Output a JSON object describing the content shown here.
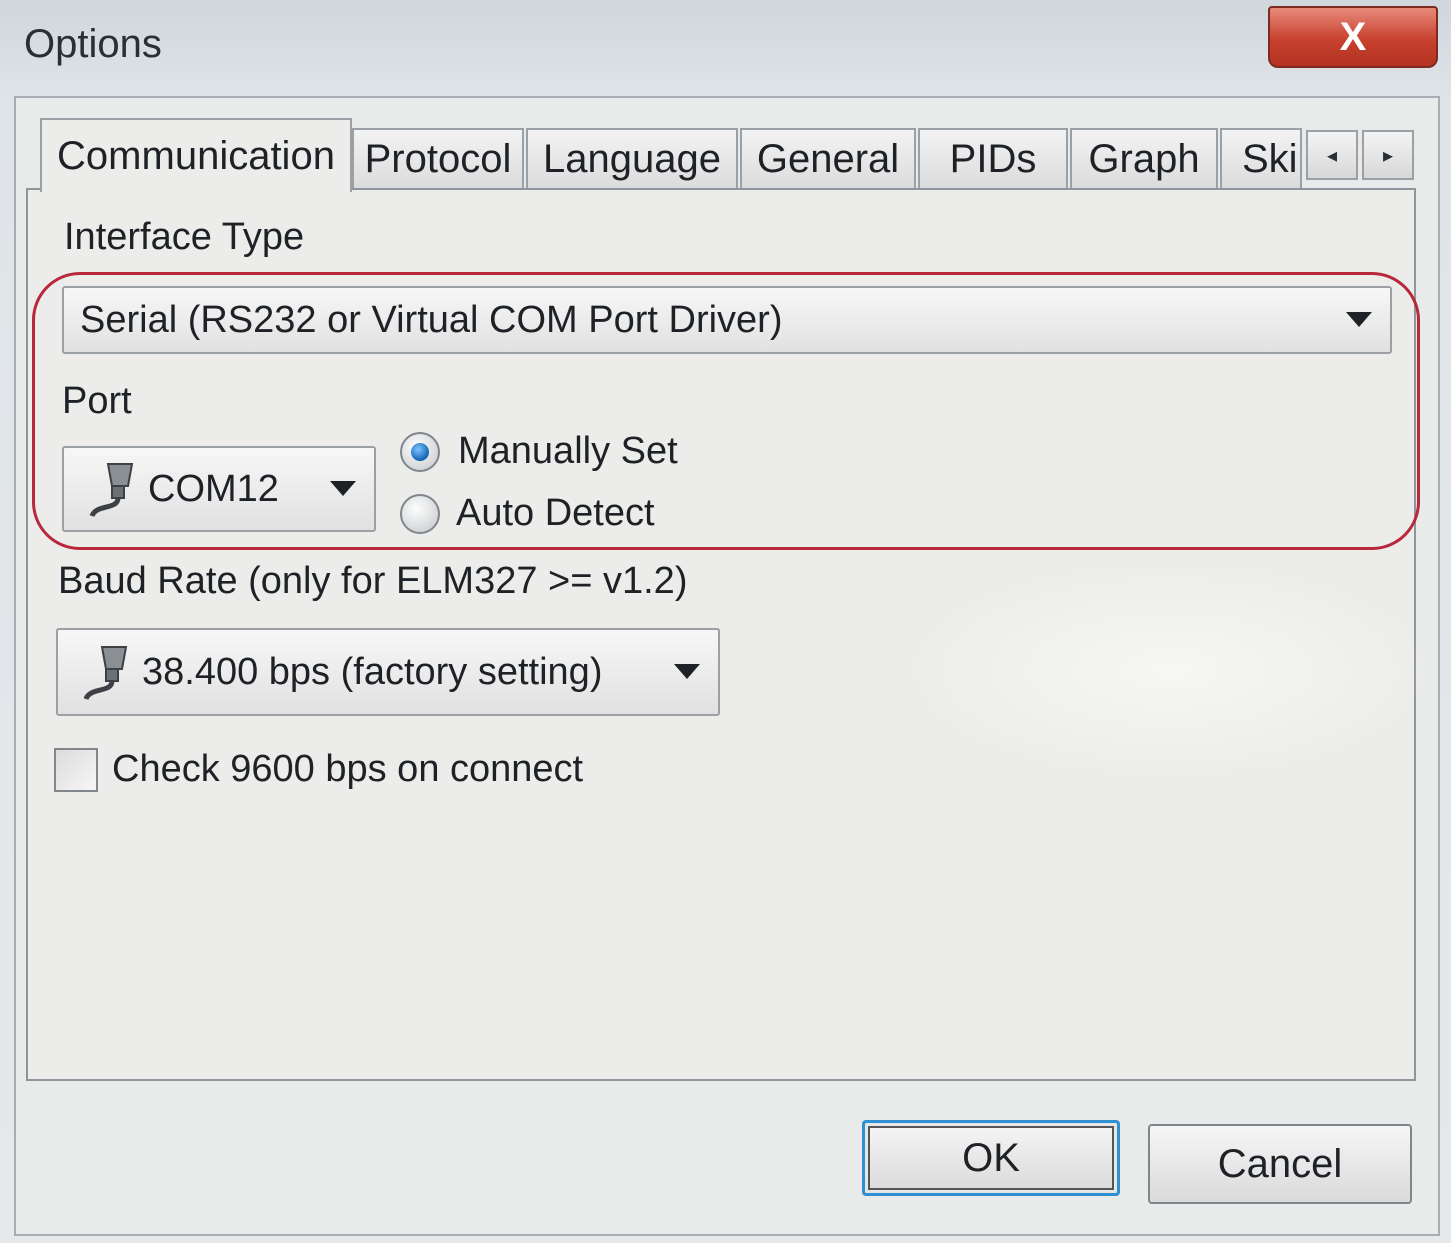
{
  "window": {
    "title": "Options",
    "close_label": "X"
  },
  "tabs": [
    {
      "label": "Communication",
      "active": true
    },
    {
      "label": "Protocol",
      "active": false
    },
    {
      "label": "Language",
      "active": false
    },
    {
      "label": "General",
      "active": false
    },
    {
      "label": "PIDs",
      "active": false
    },
    {
      "label": "Graph",
      "active": false
    },
    {
      "label": "Ski",
      "active": false
    }
  ],
  "tab_scroll": {
    "left": "◂",
    "right": "▸"
  },
  "interface_type": {
    "label": "Interface Type",
    "selected": "Serial (RS232 or Virtual COM Port Driver)"
  },
  "port": {
    "label": "Port",
    "selected": "COM12",
    "icon": "serial-plug-icon",
    "mode_options": [
      {
        "label": "Manually Set",
        "checked": true
      },
      {
        "label": "Auto Detect",
        "checked": false
      }
    ]
  },
  "baud_rate": {
    "label": "Baud Rate (only for ELM327 >= v1.2)",
    "selected": "38.400 bps (factory setting)",
    "icon": "serial-plug-icon"
  },
  "check_9600": {
    "label": "Check 9600 bps on connect",
    "checked": false
  },
  "buttons": {
    "ok": "OK",
    "cancel": "Cancel"
  },
  "colors": {
    "highlight": "#b8283a",
    "radio_selected": "#1165b5",
    "close_button": "#c8412f",
    "default_button_focus": "#2f8fd0"
  }
}
